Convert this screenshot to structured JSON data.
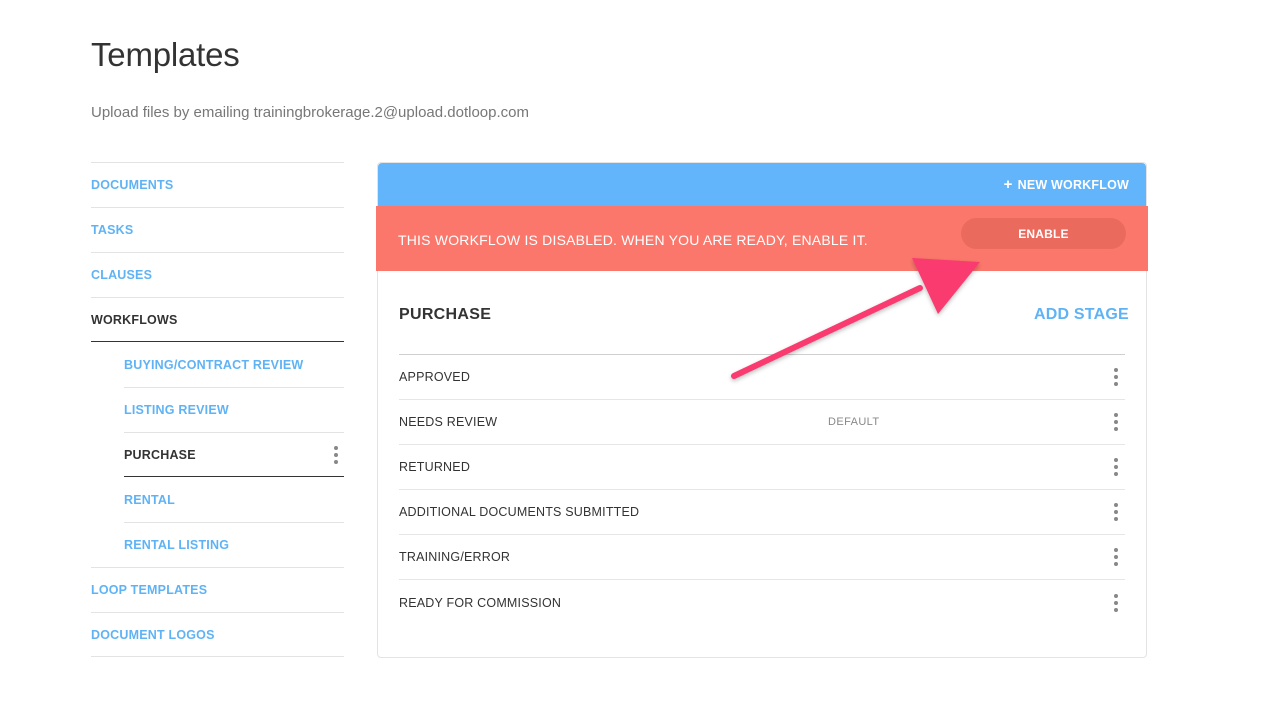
{
  "page": {
    "title": "Templates",
    "subtitle": "Upload files by emailing trainingbrokerage.2@upload.dotloop.com"
  },
  "sidebar": {
    "items": [
      {
        "label": "DOCUMENTS"
      },
      {
        "label": "TASKS"
      },
      {
        "label": "CLAUSES"
      },
      {
        "label": "WORKFLOWS"
      },
      {
        "label": "BUYING/CONTRACT REVIEW"
      },
      {
        "label": "LISTING REVIEW"
      },
      {
        "label": "PURCHASE"
      },
      {
        "label": "RENTAL"
      },
      {
        "label": "RENTAL LISTING"
      },
      {
        "label": "LOOP TEMPLATES"
      },
      {
        "label": "DOCUMENT LOGOS"
      }
    ]
  },
  "toolbar": {
    "new_workflow_icon": "+",
    "new_workflow_label": "NEW WORKFLOW"
  },
  "alert": {
    "message": "THIS WORKFLOW IS DISABLED. WHEN YOU ARE READY, ENABLE IT.",
    "enable_label": "ENABLE"
  },
  "workflow": {
    "title": "PURCHASE",
    "add_stage_label": "ADD STAGE",
    "stages": [
      {
        "name": "APPROVED",
        "badge": ""
      },
      {
        "name": "NEEDS REVIEW",
        "badge": "DEFAULT"
      },
      {
        "name": "RETURNED",
        "badge": ""
      },
      {
        "name": "ADDITIONAL DOCUMENTS SUBMITTED",
        "badge": ""
      },
      {
        "name": "TRAINING/ERROR",
        "badge": ""
      },
      {
        "name": "READY FOR COMMISSION",
        "badge": ""
      }
    ]
  },
  "colors": {
    "accent": "#5fb3f5",
    "header_bar": "#62b4fb",
    "alert": "#fb776b",
    "alert_button": "#ea6a5e",
    "annotation_arrow": "#f93b6f"
  },
  "icons": {
    "kebab": "kebab-menu-icon",
    "plus": "plus-icon",
    "annotation": "annotation-arrow-icon"
  }
}
